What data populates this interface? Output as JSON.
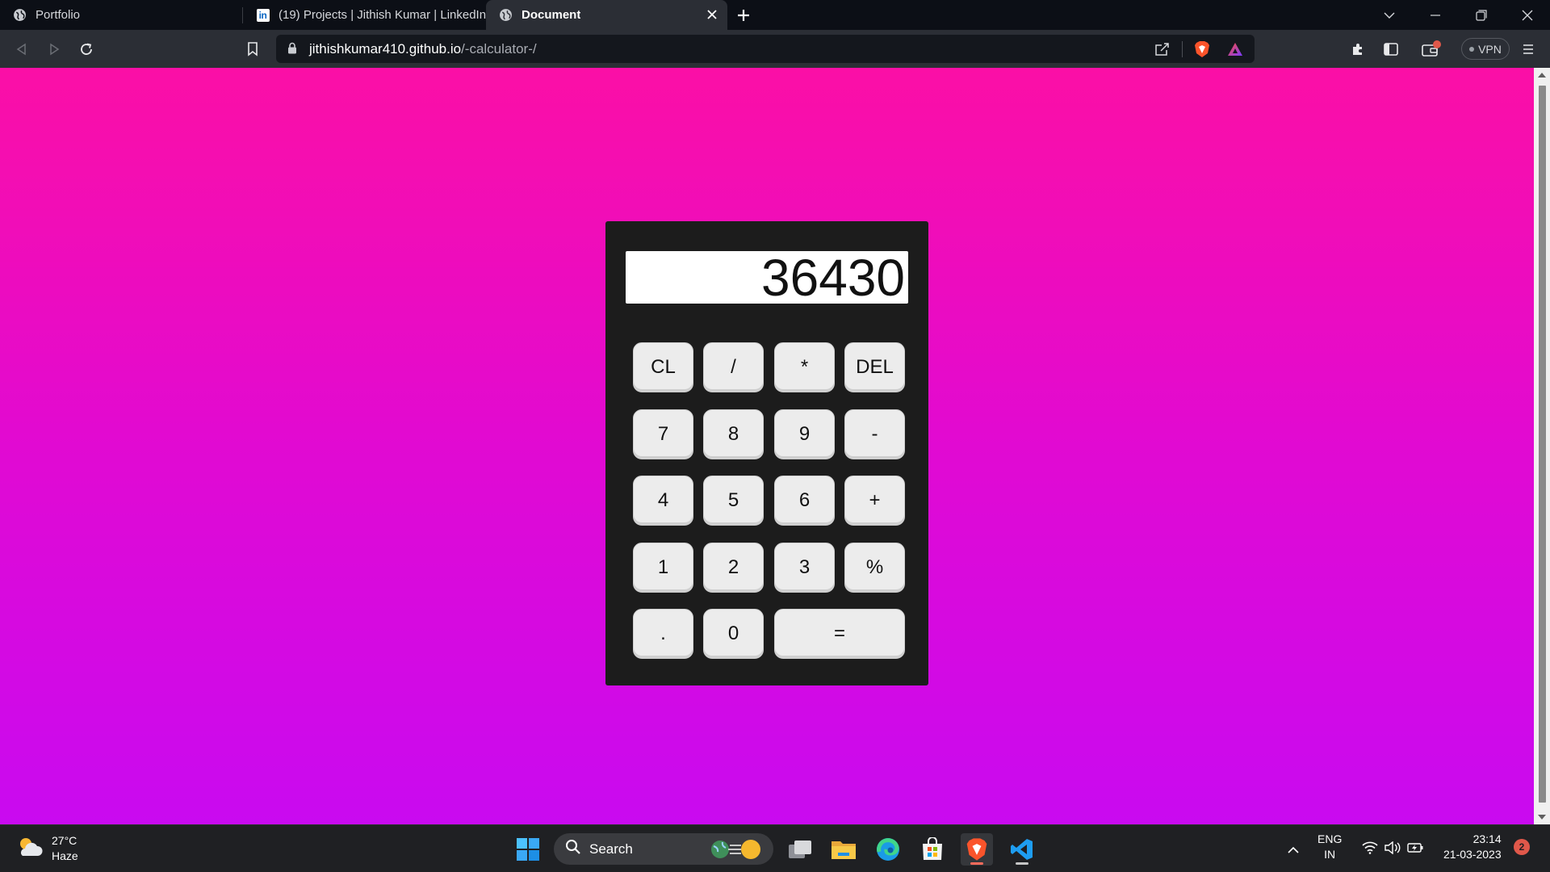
{
  "browser": {
    "tabs": [
      {
        "title": "Portfolio",
        "icon": "globe-icon"
      },
      {
        "title": "(19) Projects | Jithish Kumar | LinkedIn",
        "icon": "linkedin-icon",
        "icon_text": "in"
      },
      {
        "title": "Document",
        "icon": "globe-icon",
        "active": true
      }
    ],
    "url_host": "jithishkumar410.github.io",
    "url_path": "/-calculator-/",
    "vpn_label": "VPN"
  },
  "calculator": {
    "display_value": "36430",
    "keys": [
      {
        "label": "CL",
        "name": "clear"
      },
      {
        "label": "/",
        "name": "divide"
      },
      {
        "label": "*",
        "name": "multiply"
      },
      {
        "label": "DEL",
        "name": "delete"
      },
      {
        "label": "7",
        "name": "digit-7"
      },
      {
        "label": "8",
        "name": "digit-8"
      },
      {
        "label": "9",
        "name": "digit-9"
      },
      {
        "label": "-",
        "name": "subtract"
      },
      {
        "label": "4",
        "name": "digit-4"
      },
      {
        "label": "5",
        "name": "digit-5"
      },
      {
        "label": "6",
        "name": "digit-6"
      },
      {
        "label": "+",
        "name": "add"
      },
      {
        "label": "1",
        "name": "digit-1"
      },
      {
        "label": "2",
        "name": "digit-2"
      },
      {
        "label": "3",
        "name": "digit-3"
      },
      {
        "label": "%",
        "name": "percent"
      },
      {
        "label": ".",
        "name": "decimal"
      },
      {
        "label": "0",
        "name": "digit-0"
      },
      {
        "label": "=",
        "name": "equals"
      }
    ]
  },
  "taskbar": {
    "weather_temp": "27°C",
    "weather_desc": "Haze",
    "search_label": "Search",
    "lang_primary": "ENG",
    "lang_secondary": "IN",
    "time": "23:14",
    "date": "21-03-2023",
    "notification_count": "2"
  },
  "colors": {
    "page_gradient_top": "#fb0fa6",
    "page_gradient_bottom": "#c90af0",
    "calculator_body": "#1c1c1c",
    "key_face": "#ececec"
  }
}
